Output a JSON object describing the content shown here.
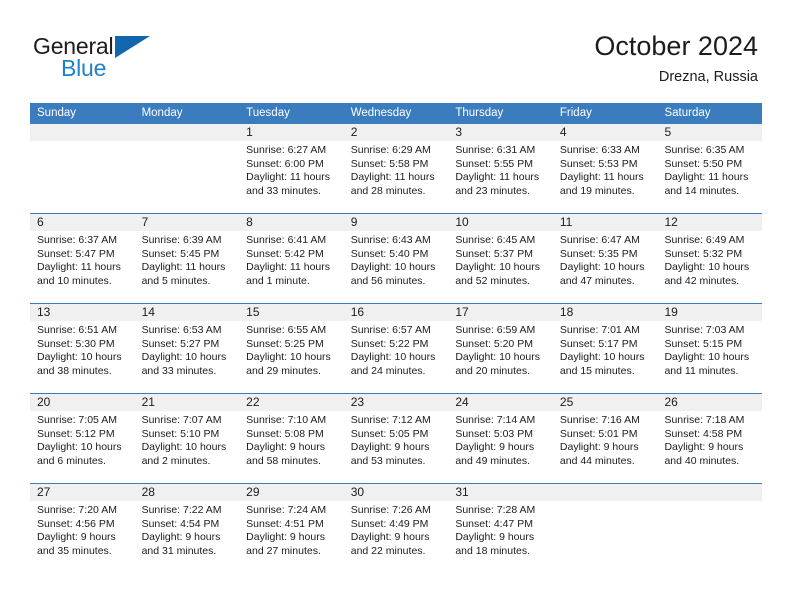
{
  "brand": {
    "word1": "General",
    "word2": "Blue",
    "logo_icon": "triangle-logo-icon"
  },
  "header": {
    "title": "October 2024",
    "location": "Drezna, Russia"
  },
  "colors": {
    "header_blue": "#3a7cbe",
    "brand_blue": "#1e82c8",
    "logo_blue": "#1266ad",
    "day_band": "#f0f0f0",
    "text": "#1c1c1c"
  },
  "weekdays": [
    "Sunday",
    "Monday",
    "Tuesday",
    "Wednesday",
    "Thursday",
    "Friday",
    "Saturday"
  ],
  "labels": {
    "sunrise_prefix": "Sunrise:",
    "sunset_prefix": "Sunset:",
    "daylight_prefix": "Daylight:"
  },
  "weeks": [
    [
      {
        "day": "",
        "sunrise": "",
        "sunset": "",
        "daylight": ""
      },
      {
        "day": "",
        "sunrise": "",
        "sunset": "",
        "daylight": ""
      },
      {
        "day": "1",
        "sunrise": "Sunrise: 6:27 AM",
        "sunset": "Sunset: 6:00 PM",
        "daylight": "Daylight: 11 hours and 33 minutes."
      },
      {
        "day": "2",
        "sunrise": "Sunrise: 6:29 AM",
        "sunset": "Sunset: 5:58 PM",
        "daylight": "Daylight: 11 hours and 28 minutes."
      },
      {
        "day": "3",
        "sunrise": "Sunrise: 6:31 AM",
        "sunset": "Sunset: 5:55 PM",
        "daylight": "Daylight: 11 hours and 23 minutes."
      },
      {
        "day": "4",
        "sunrise": "Sunrise: 6:33 AM",
        "sunset": "Sunset: 5:53 PM",
        "daylight": "Daylight: 11 hours and 19 minutes."
      },
      {
        "day": "5",
        "sunrise": "Sunrise: 6:35 AM",
        "sunset": "Sunset: 5:50 PM",
        "daylight": "Daylight: 11 hours and 14 minutes."
      }
    ],
    [
      {
        "day": "6",
        "sunrise": "Sunrise: 6:37 AM",
        "sunset": "Sunset: 5:47 PM",
        "daylight": "Daylight: 11 hours and 10 minutes."
      },
      {
        "day": "7",
        "sunrise": "Sunrise: 6:39 AM",
        "sunset": "Sunset: 5:45 PM",
        "daylight": "Daylight: 11 hours and 5 minutes."
      },
      {
        "day": "8",
        "sunrise": "Sunrise: 6:41 AM",
        "sunset": "Sunset: 5:42 PM",
        "daylight": "Daylight: 11 hours and 1 minute."
      },
      {
        "day": "9",
        "sunrise": "Sunrise: 6:43 AM",
        "sunset": "Sunset: 5:40 PM",
        "daylight": "Daylight: 10 hours and 56 minutes."
      },
      {
        "day": "10",
        "sunrise": "Sunrise: 6:45 AM",
        "sunset": "Sunset: 5:37 PM",
        "daylight": "Daylight: 10 hours and 52 minutes."
      },
      {
        "day": "11",
        "sunrise": "Sunrise: 6:47 AM",
        "sunset": "Sunset: 5:35 PM",
        "daylight": "Daylight: 10 hours and 47 minutes."
      },
      {
        "day": "12",
        "sunrise": "Sunrise: 6:49 AM",
        "sunset": "Sunset: 5:32 PM",
        "daylight": "Daylight: 10 hours and 42 minutes."
      }
    ],
    [
      {
        "day": "13",
        "sunrise": "Sunrise: 6:51 AM",
        "sunset": "Sunset: 5:30 PM",
        "daylight": "Daylight: 10 hours and 38 minutes."
      },
      {
        "day": "14",
        "sunrise": "Sunrise: 6:53 AM",
        "sunset": "Sunset: 5:27 PM",
        "daylight": "Daylight: 10 hours and 33 minutes."
      },
      {
        "day": "15",
        "sunrise": "Sunrise: 6:55 AM",
        "sunset": "Sunset: 5:25 PM",
        "daylight": "Daylight: 10 hours and 29 minutes."
      },
      {
        "day": "16",
        "sunrise": "Sunrise: 6:57 AM",
        "sunset": "Sunset: 5:22 PM",
        "daylight": "Daylight: 10 hours and 24 minutes."
      },
      {
        "day": "17",
        "sunrise": "Sunrise: 6:59 AM",
        "sunset": "Sunset: 5:20 PM",
        "daylight": "Daylight: 10 hours and 20 minutes."
      },
      {
        "day": "18",
        "sunrise": "Sunrise: 7:01 AM",
        "sunset": "Sunset: 5:17 PM",
        "daylight": "Daylight: 10 hours and 15 minutes."
      },
      {
        "day": "19",
        "sunrise": "Sunrise: 7:03 AM",
        "sunset": "Sunset: 5:15 PM",
        "daylight": "Daylight: 10 hours and 11 minutes."
      }
    ],
    [
      {
        "day": "20",
        "sunrise": "Sunrise: 7:05 AM",
        "sunset": "Sunset: 5:12 PM",
        "daylight": "Daylight: 10 hours and 6 minutes."
      },
      {
        "day": "21",
        "sunrise": "Sunrise: 7:07 AM",
        "sunset": "Sunset: 5:10 PM",
        "daylight": "Daylight: 10 hours and 2 minutes."
      },
      {
        "day": "22",
        "sunrise": "Sunrise: 7:10 AM",
        "sunset": "Sunset: 5:08 PM",
        "daylight": "Daylight: 9 hours and 58 minutes."
      },
      {
        "day": "23",
        "sunrise": "Sunrise: 7:12 AM",
        "sunset": "Sunset: 5:05 PM",
        "daylight": "Daylight: 9 hours and 53 minutes."
      },
      {
        "day": "24",
        "sunrise": "Sunrise: 7:14 AM",
        "sunset": "Sunset: 5:03 PM",
        "daylight": "Daylight: 9 hours and 49 minutes."
      },
      {
        "day": "25",
        "sunrise": "Sunrise: 7:16 AM",
        "sunset": "Sunset: 5:01 PM",
        "daylight": "Daylight: 9 hours and 44 minutes."
      },
      {
        "day": "26",
        "sunrise": "Sunrise: 7:18 AM",
        "sunset": "Sunset: 4:58 PM",
        "daylight": "Daylight: 9 hours and 40 minutes."
      }
    ],
    [
      {
        "day": "27",
        "sunrise": "Sunrise: 7:20 AM",
        "sunset": "Sunset: 4:56 PM",
        "daylight": "Daylight: 9 hours and 35 minutes."
      },
      {
        "day": "28",
        "sunrise": "Sunrise: 7:22 AM",
        "sunset": "Sunset: 4:54 PM",
        "daylight": "Daylight: 9 hours and 31 minutes."
      },
      {
        "day": "29",
        "sunrise": "Sunrise: 7:24 AM",
        "sunset": "Sunset: 4:51 PM",
        "daylight": "Daylight: 9 hours and 27 minutes."
      },
      {
        "day": "30",
        "sunrise": "Sunrise: 7:26 AM",
        "sunset": "Sunset: 4:49 PM",
        "daylight": "Daylight: 9 hours and 22 minutes."
      },
      {
        "day": "31",
        "sunrise": "Sunrise: 7:28 AM",
        "sunset": "Sunset: 4:47 PM",
        "daylight": "Daylight: 9 hours and 18 minutes."
      },
      {
        "day": "",
        "sunrise": "",
        "sunset": "",
        "daylight": ""
      },
      {
        "day": "",
        "sunrise": "",
        "sunset": "",
        "daylight": ""
      }
    ]
  ]
}
